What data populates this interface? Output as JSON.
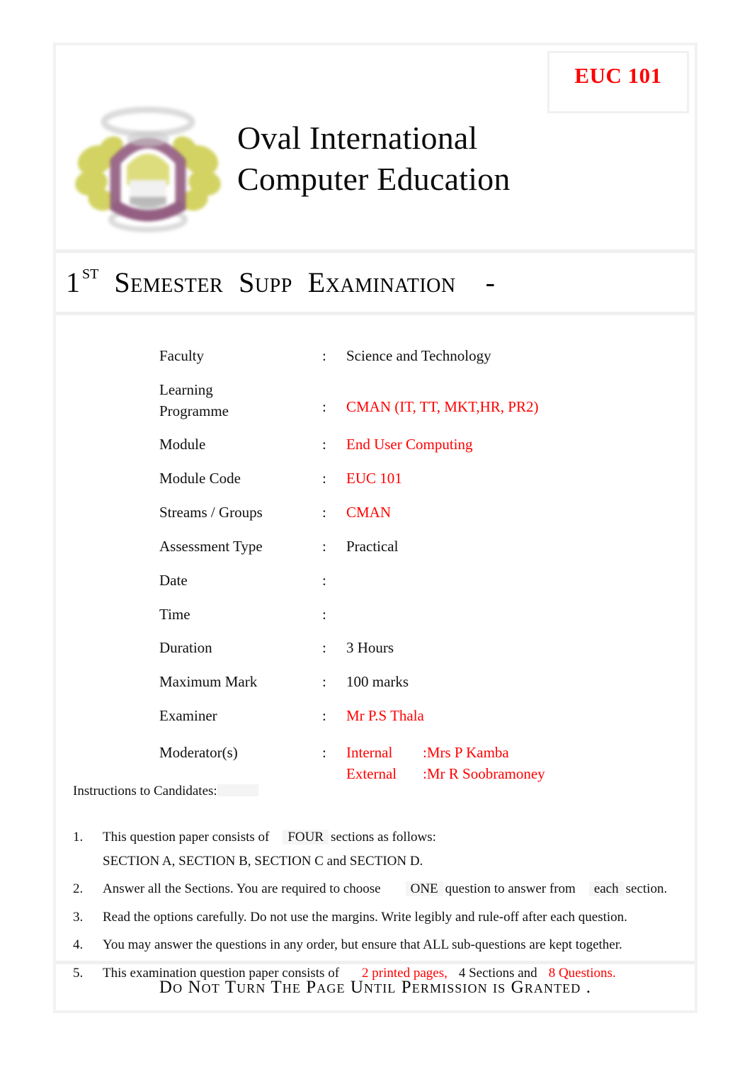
{
  "header": {
    "module_code_badge": "EUC 101",
    "institution_line1": "Oval International",
    "institution_line2": "Computer Education",
    "logo_alt": "oval-international-crest"
  },
  "exam_heading": {
    "number": "1",
    "ordinal_suffix": "st",
    "words": [
      "Semester",
      "Supp",
      "Examination"
    ],
    "trailing_dash": "-"
  },
  "details": {
    "separator": ":",
    "rows": [
      {
        "label": "Faculty",
        "value": "Science and Technology",
        "red": false
      },
      {
        "label_line1": "Learning",
        "label_line2": "Programme",
        "value": "CMAN (IT, TT, MKT,HR, PR2)",
        "red": true
      },
      {
        "label": "Module",
        "value": "End User Computing",
        "red": true
      },
      {
        "label": "Module Code",
        "value": "EUC 101",
        "red": true
      },
      {
        "label": "Streams / Groups",
        "value": "CMAN",
        "red": true
      },
      {
        "label": "Assessment Type",
        "value": "Practical",
        "red": false
      },
      {
        "label": "Date",
        "value": "",
        "red": false
      },
      {
        "label": "Time",
        "value": "",
        "red": false
      },
      {
        "label": "Duration",
        "value": "3 Hours",
        "red": false
      },
      {
        "label": "Maximum Mark",
        "value": "100 marks",
        "red": false
      },
      {
        "label": "Examiner",
        "value": "Mr P.S Thala",
        "red": true
      }
    ],
    "moderators": {
      "label": "Moderator(s)",
      "internal_kind": "Internal",
      "internal_sep": ": ",
      "internal_name": "Mrs P Kamba",
      "external_kind": "External",
      "external_sep": ": ",
      "external_name": "Mr R Soobramoney"
    }
  },
  "instructions": {
    "heading": "Instructions to Candidates:",
    "items": [
      {
        "number": "1.",
        "text_a": "This question paper consists of",
        "highlight": "FOUR",
        "text_b": "sections as follows:",
        "subline": "SECTION A, SECTION B, SECTION C and SECTION D."
      },
      {
        "number": "2.",
        "text_a": "Answer all the Sections. You are required to choose",
        "highlight": "ONE",
        "text_b": "question to answer from",
        "highlight2": "each",
        "text_c": "section."
      },
      {
        "number": "3.",
        "text_a": "Read the options carefully. Do not use the margins. Write legibly and rule-off after each question."
      },
      {
        "number": "4.",
        "text_a": "You may answer the questions in any order, but ensure that ALL sub-questions are kept together."
      },
      {
        "number": "5.",
        "text_a": "This examination question paper consists of",
        "red_a": "2 printed pages,",
        "text_b": "4 Sections and",
        "red_b": "8 Questions."
      }
    ]
  },
  "footer": {
    "notice": "Do Not Turn The Page Until Permission  is Granted ."
  },
  "colors": {
    "accent_red": "#ff0000",
    "text": "#101010",
    "rule": "#f0f0f0",
    "highlight_shade": "#f5f5f5"
  }
}
